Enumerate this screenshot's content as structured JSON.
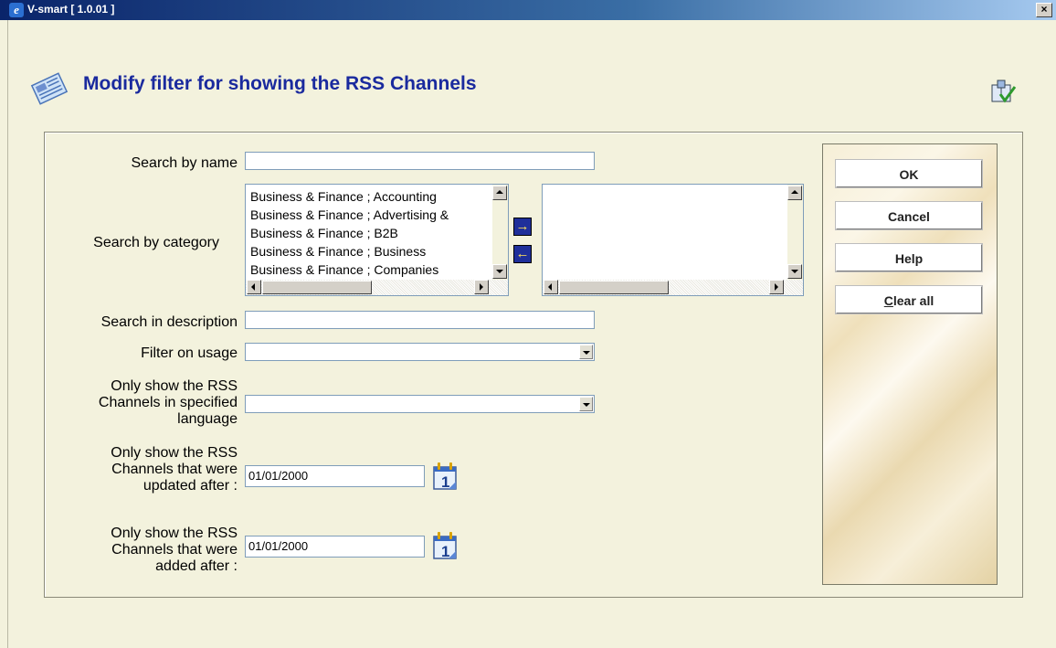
{
  "window": {
    "title": "V-smart [ 1.0.01 ]",
    "close_label": "×"
  },
  "page": {
    "title": "Modify filter for showing the RSS Channels"
  },
  "form": {
    "search_by_name_label": "Search by name",
    "search_by_name_value": "",
    "search_by_category_label": "Search by category",
    "category_options": [
      "Business & Finance ; Accounting",
      "Business & Finance ; Advertising &",
      "Business & Finance ; B2B",
      "Business & Finance ; Business",
      "Business & Finance ; Companies"
    ],
    "move_right_glyph": "→",
    "move_left_glyph": "←",
    "search_in_description_label": "Search in description",
    "search_in_description_value": "",
    "filter_on_usage_label": "Filter on usage",
    "filter_on_usage_value": "",
    "language_label_lines": [
      "Only show the RSS",
      "Channels in specified",
      "language"
    ],
    "language_value": "",
    "updated_after_label_lines": [
      "Only show the RSS",
      "Channels that were",
      "updated after :"
    ],
    "updated_after_value": "01/01/2000",
    "added_after_label_lines": [
      "Only show the RSS",
      "Channels that were",
      "added after :"
    ],
    "added_after_value": "01/01/2000",
    "calendar_day": "1"
  },
  "actions": {
    "ok": "OK",
    "cancel": "Cancel",
    "help": "Help",
    "clear_all_access": "C",
    "clear_all_rest": "lear all"
  },
  "icons": {
    "header": "newspaper-icon",
    "top_right": "submit-check-icon",
    "calendar": "calendar-icon"
  }
}
